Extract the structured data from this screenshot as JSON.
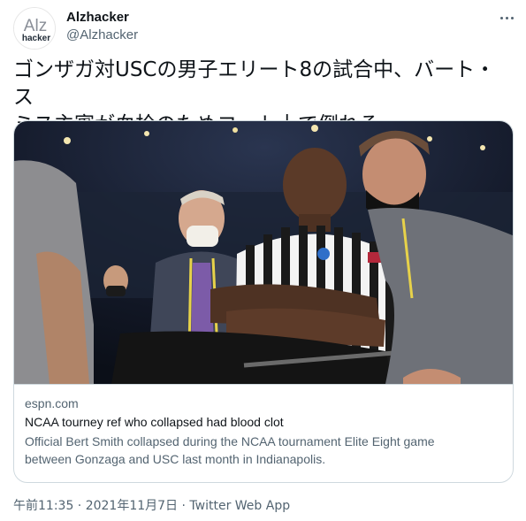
{
  "author": {
    "avatar_text": "Alz",
    "avatar_subtext": "hacker",
    "display_name": "Alzhacker",
    "handle": "@Alzhacker"
  },
  "tweet": {
    "text_line1": "ゴンザガ対USCの男子エリート8の試合中、バート・ス",
    "text_line2": "ミス主審が血栓のためコート上で倒れる。"
  },
  "card": {
    "domain": "espn.com",
    "title": "NCAA tourney ref who collapsed had blood clot",
    "description_line1": "Official Bert Smith collapsed during the NCAA tournament Elite Eight game",
    "description_line2": "between Gonzaga and USC last month in Indianapolis."
  },
  "meta": {
    "timestamp": "午前11:35 · 2021年11月7日",
    "separator": " · ",
    "source": "Twitter Web App"
  },
  "icons": {
    "more": "more-horizontal-icon"
  }
}
